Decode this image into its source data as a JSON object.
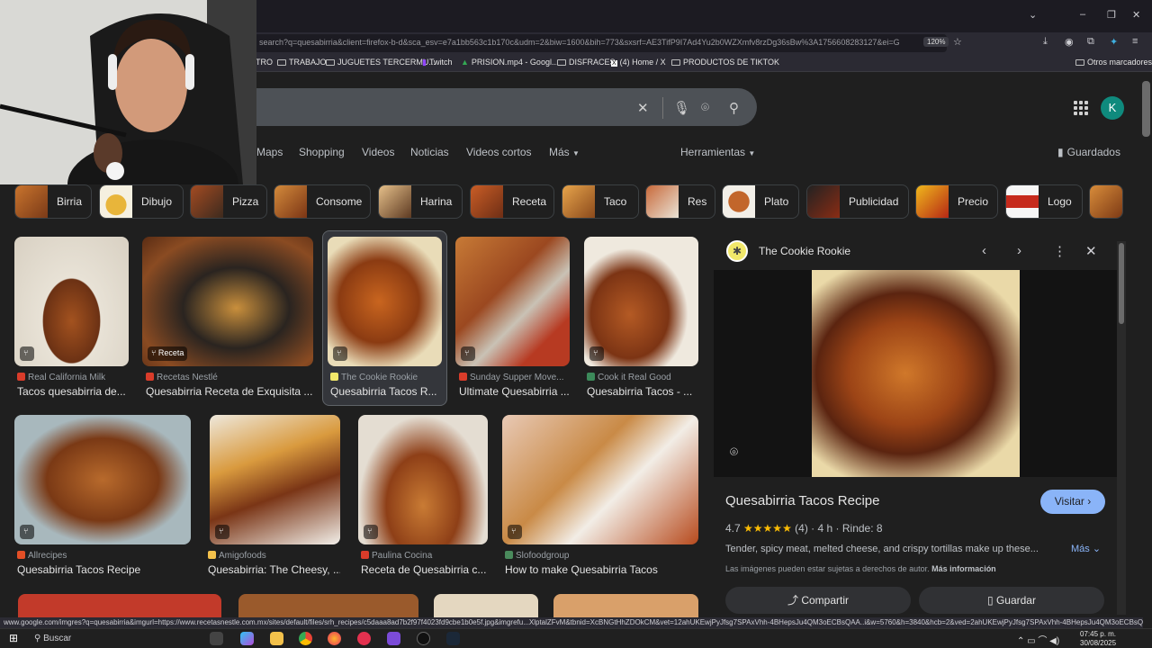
{
  "browser": {
    "url": "search?q=quesabirria&client=firefox-b-d&sca_esv=e7a1bb563c1b170c&udm=2&biw=1600&bih=773&sxsrf=AE3TifP9I7Ad4Yu2b0WZXmfv8rzDg36sBw%3A1756608283127&ei=G",
    "zoom": "120%",
    "bookmarks": [
      "TRO",
      "TRABAJO",
      "JUGUETES TERCERMU...",
      "Twitch",
      "PRISION.mp4 - Googl...",
      "DISFRACES",
      "(4) Home / X",
      "PRODUCTOS DE TIKTOK"
    ],
    "other_bookmarks": "Otros marcadores",
    "status_url": "www.google.com/imgres?q=quesabirria&imgurl=https://www.recetasnestle.com.mx/sites/default/files/srh_recipes/c5daaa8ad7b2f97f4023fd9cbe1b0e5f.jpg&imgrefu...XlptalZFvM&tbnid=XcBNGtHhZDOkCM&vet=12ahUKEwjPyJfsg7SPAxVhh-4BHepsJu4QM3oECBsQAA..i&w=5760&h=3840&hcb=2&ved=2ahUKEwjPyJfsg7SPAxVhh-4BHepsJu4QM3oECBsQAA"
  },
  "header": {
    "avatar_letter": "K",
    "tabs": [
      "Maps",
      "Shopping",
      "Videos",
      "Noticias",
      "Videos cortos",
      "Más"
    ],
    "tools": "Herramientas",
    "saved": "Guardados"
  },
  "chips": [
    "Birria",
    "Dibujo",
    "Pizza",
    "Consome",
    "Harina",
    "Receta",
    "Taco",
    "Res",
    "Plato",
    "Publicidad",
    "Precio",
    "Logo"
  ],
  "results_row1": [
    {
      "source": "Real California Milk",
      "title": "Tacos quesabirria de...",
      "badge": ""
    },
    {
      "source": "Recetas Nestlé",
      "title": "Quesabirria Receta de Exquisita ...",
      "badge": "Receta"
    },
    {
      "source": "The Cookie Rookie",
      "title": "Quesabirria Tacos R...",
      "badge": ""
    },
    {
      "source": "Sunday Supper Move...",
      "title": "Ultimate Quesabirria ...",
      "badge": ""
    },
    {
      "source": "Cook it Real Good",
      "title": "Quesabirria Tacos - ...",
      "badge": ""
    }
  ],
  "results_row2": [
    {
      "source": "Allrecipes",
      "title": "Quesabirria Tacos Recipe"
    },
    {
      "source": "Amigofoods",
      "title": "Quesabirria: The Cheesy, ..."
    },
    {
      "source": "Paulina Cocina",
      "title": "Receta de Quesabirria c..."
    },
    {
      "source": "Slofoodgroup",
      "title": "How to make Quesabirria Tacos"
    }
  ],
  "panel": {
    "site": "The Cookie Rookie",
    "title": "Quesabirria Tacos Recipe",
    "visit": "Visitar",
    "rating": "4.7",
    "stars": "★★★★★",
    "reviews": "(4)",
    "time": "4 h",
    "servings": "Rinde: 8",
    "description": "Tender, spicy meat, melted cheese, and crispy tortillas make up these...",
    "more": "Más",
    "rights": "Las imágenes pueden estar sujetas a derechos de autor.",
    "more_info": "Más información",
    "share": "Compartir",
    "save": "Guardar"
  },
  "taskbar": {
    "search": "Buscar",
    "time": "07:45 p. m.",
    "date": "30/08/2025"
  },
  "colors": {
    "accent": "#8ab4f8",
    "background": "#1f1f1f",
    "stars": "#fbbc04"
  }
}
